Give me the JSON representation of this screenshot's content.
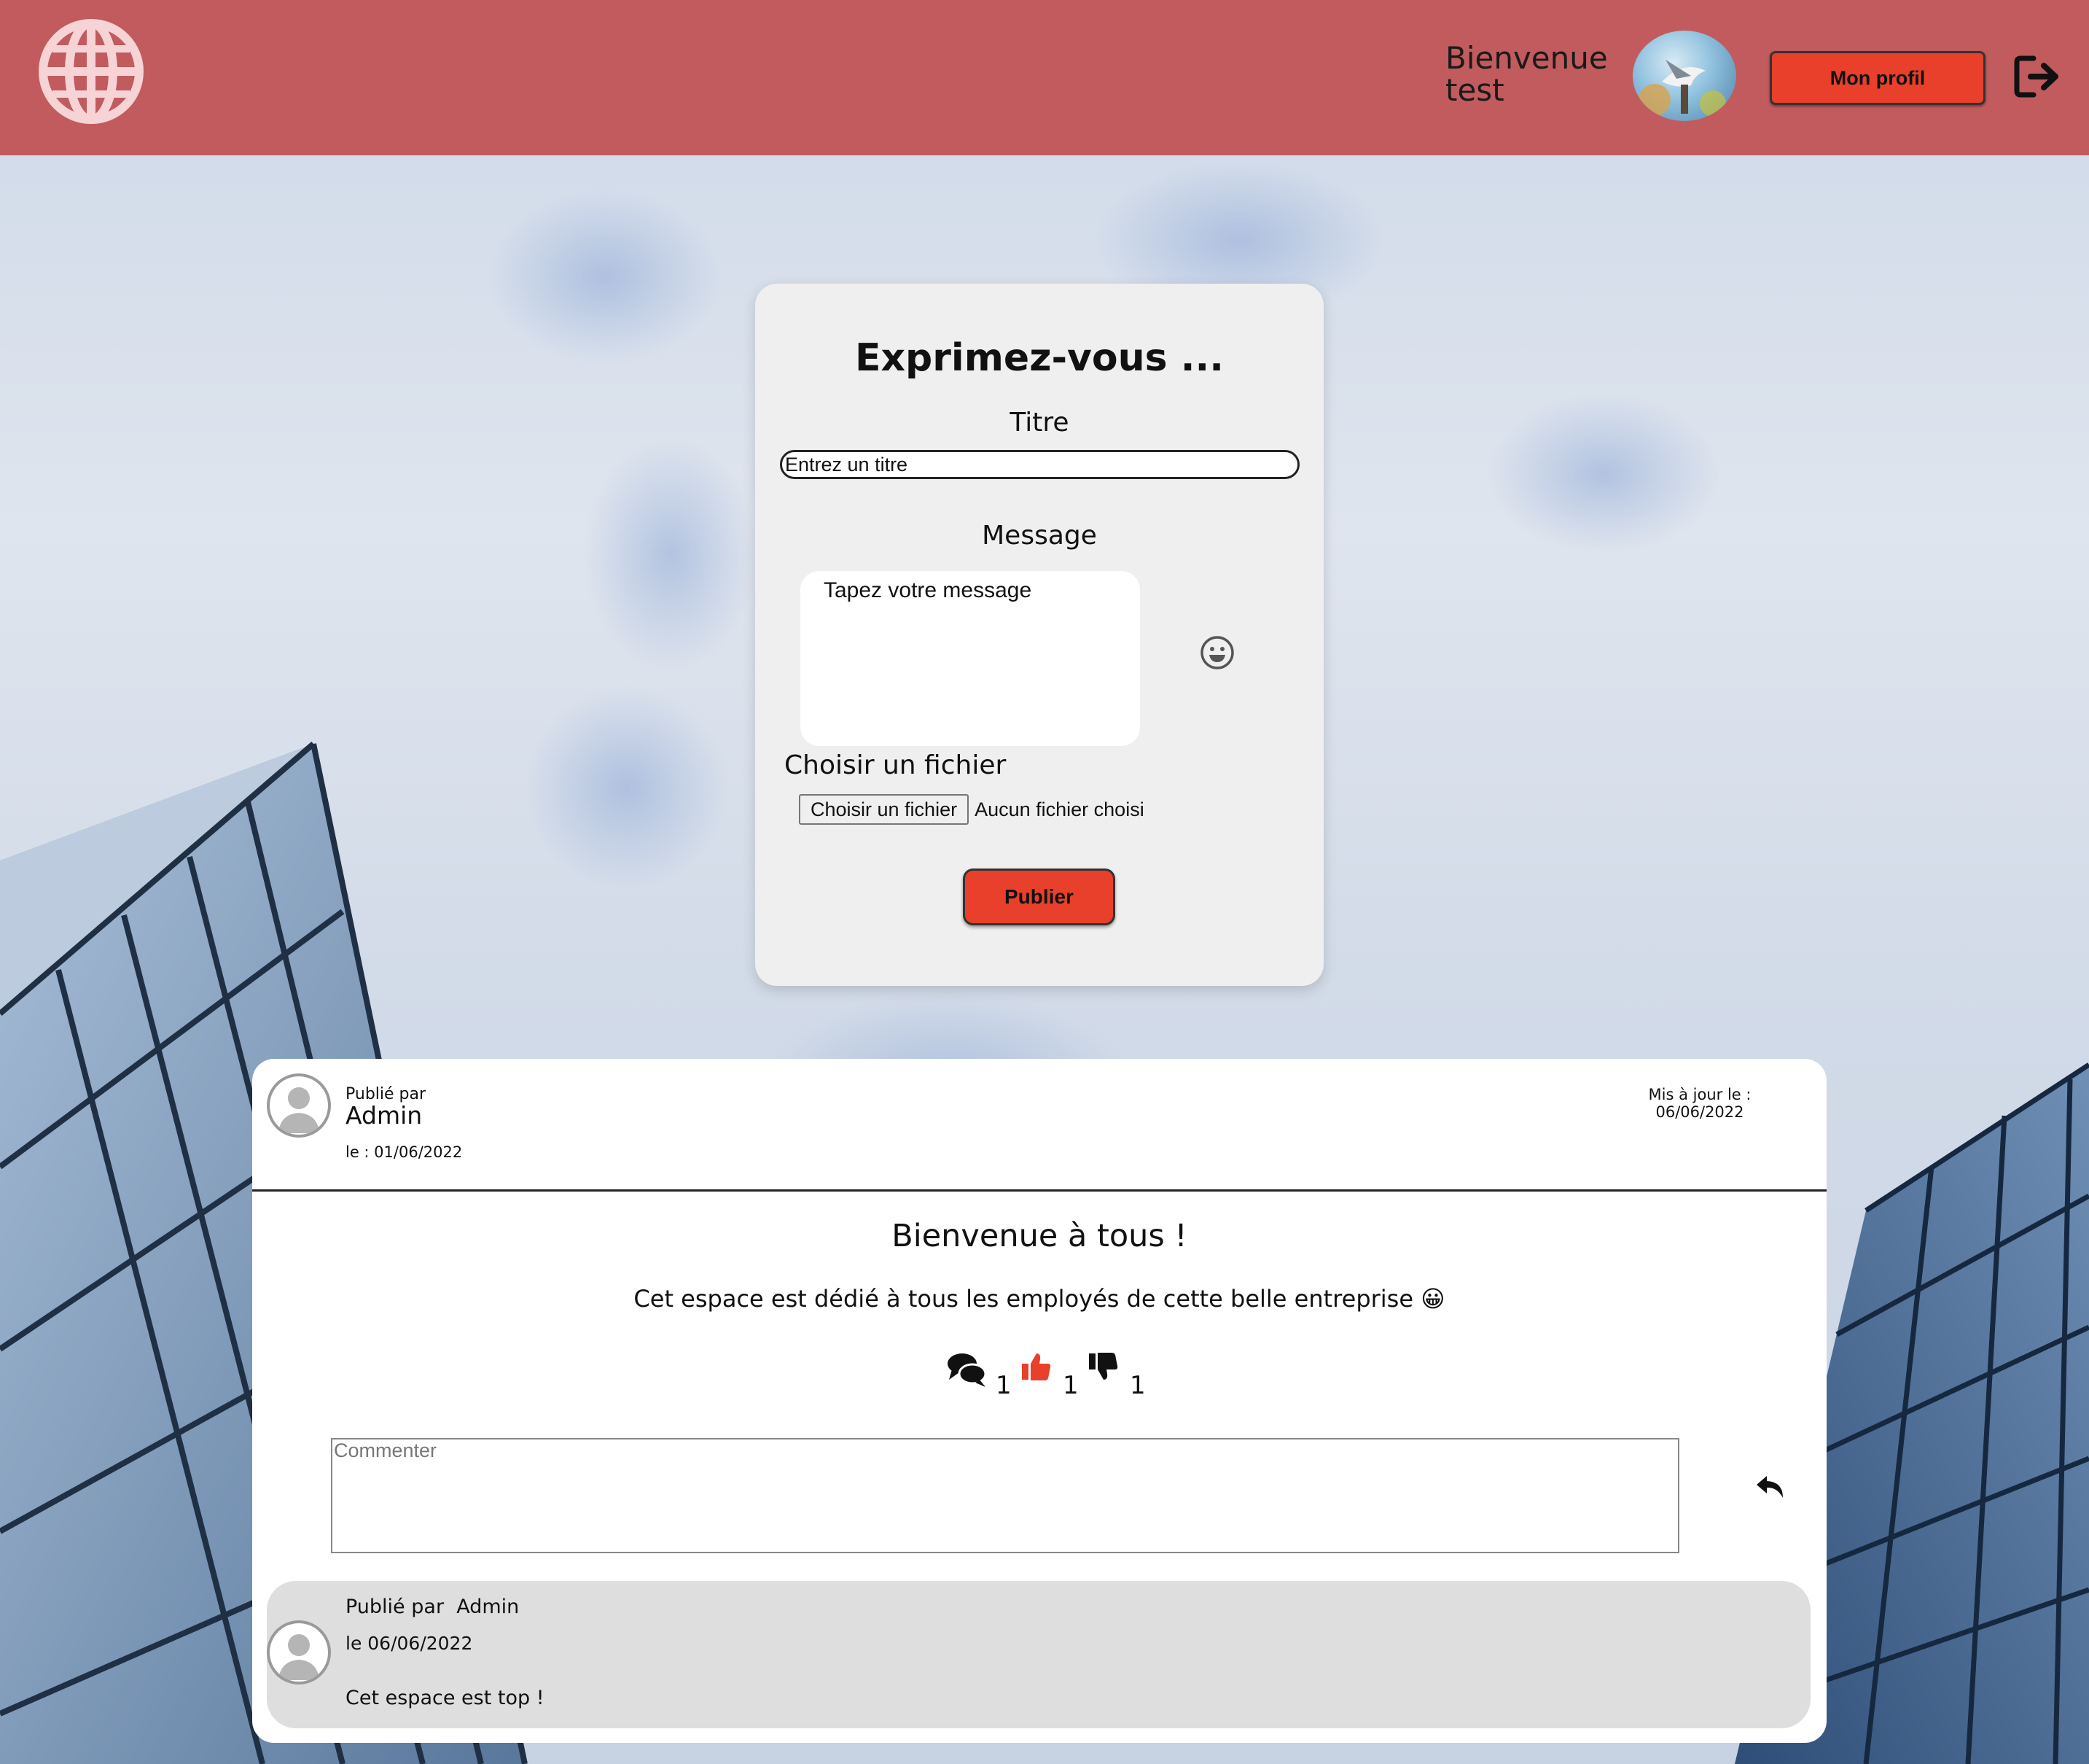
{
  "header": {
    "welcome_line1": "Bienvenue",
    "welcome_line2": "test",
    "profile_button": "Mon profil",
    "color": "#c15b5e",
    "logo_icon": "globe-icon",
    "logout_icon": "logout-icon"
  },
  "form": {
    "title": "Exprimez-vous ...",
    "title_label": "Titre",
    "title_placeholder": "Entrez un titre",
    "message_label": "Message",
    "message_placeholder": "Tapez votre message",
    "file_label": "Choisir un fichier",
    "file_button": "Choisir un fichier",
    "file_status": "Aucun fichier choisi",
    "submit": "Publier",
    "emoji_icon": "smiley-icon"
  },
  "post": {
    "published_label": "Publié par",
    "author": "Admin",
    "created": "le : 01/06/2022",
    "updated_label": "Mis à jour le :",
    "updated_date": "06/06/2022",
    "title": "Bienvenue à tous !",
    "body": "Cet espace est dédié à tous les employés de cette belle entreprise 😀",
    "reactions": {
      "comments": "1",
      "likes": "1",
      "dislikes": "1"
    },
    "comment_placeholder": "Commenter",
    "reply_icon": "reply-icon"
  },
  "comments": [
    {
      "author_line": "Publié par  Admin",
      "date": "le 06/06/2022",
      "text": "Cet espace est top !"
    }
  ],
  "colors": {
    "accent": "#e8402a",
    "like": "#e8402a",
    "card": "#efefef",
    "comment_bg": "#dedede"
  }
}
